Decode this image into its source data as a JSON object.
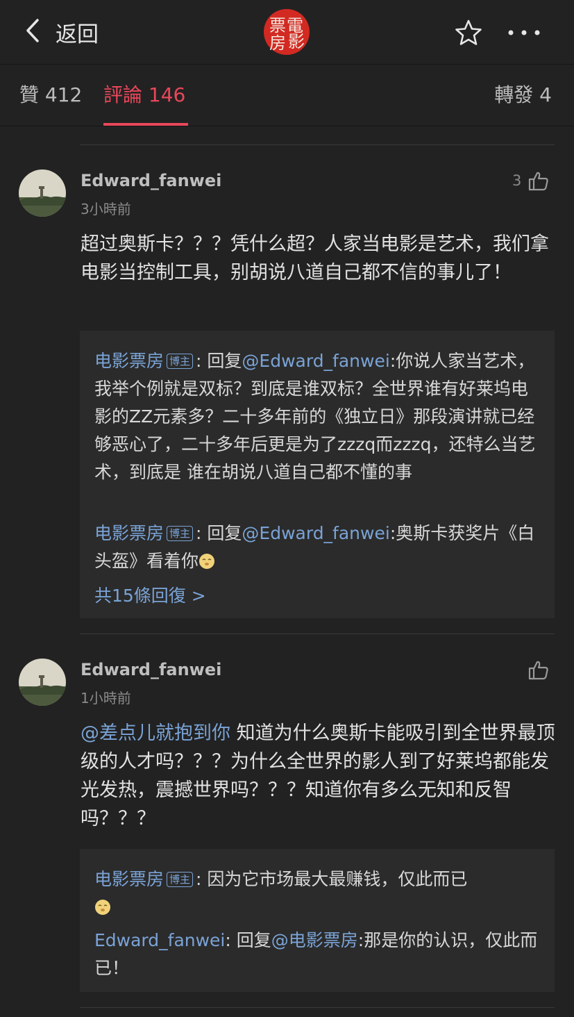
{
  "header": {
    "back_label": "返回",
    "logo_text": "電影票房",
    "logo_chars": [
      "電",
      "影",
      "票",
      "房"
    ],
    "icons": [
      "chevron-left-icon",
      "star-icon",
      "more-icon"
    ],
    "accent_color": "#e8475a",
    "logo_color": "#d22a22"
  },
  "tabs": {
    "likes": "贊 412",
    "comments": "評論 146",
    "reposts": "轉發 4"
  },
  "comments": [
    {
      "username": "Edward_fanwei",
      "time": "3小時前",
      "likes": "3",
      "text": "超过奥斯卡？？？凭什么超？人家当电影是艺术，我们拿电影当控制工具，别胡说八道自己都不信的事儿了！",
      "replies": [
        {
          "name": "电影票房",
          "badge": "博主",
          "separator": ": ",
          "reply_prefix": "回复",
          "reply_to": "@Edward_fanwei",
          "text": ":你说人家当艺术，我举个例就是双标？到底是谁双标？全世界谁有好莱坞电影的ZZ元素多？二十多年前的《独立日》那段演讲就已经够恶心了，二十多年后更是为了zzzq而zzzq，还特么当艺术，到底是 谁在胡说八道自己都不懂的事"
        },
        {
          "name": "电影票房",
          "badge": "博主",
          "separator": ": ",
          "reply_prefix": "回复",
          "reply_to": "@Edward_fanwei",
          "text": ":奥斯卡获奖片《白头盔》看着你"
        }
      ],
      "more_replies": "共15條回復 >"
    },
    {
      "username": "Edward_fanwei",
      "time": "1小時前",
      "mention": "@差点儿就抱到你",
      "text": " 知道为什么奥斯卡能吸引到全世界最顶级的人才吗？？？为什么全世界的影人到了好莱坞都能发光发热，震撼世界吗？？？知道你有多么无知和反智吗？？？",
      "replies": [
        {
          "name": "电影票房",
          "badge": "博主",
          "separator": ": ",
          "text": "因为它市场最大最赚钱，仅此而已"
        },
        {
          "name": "Edward_fanwei",
          "separator": ": ",
          "reply_prefix": "回复",
          "reply_to": "@电影票房",
          "text": ":那是你的认识，仅此而已！"
        }
      ]
    }
  ]
}
